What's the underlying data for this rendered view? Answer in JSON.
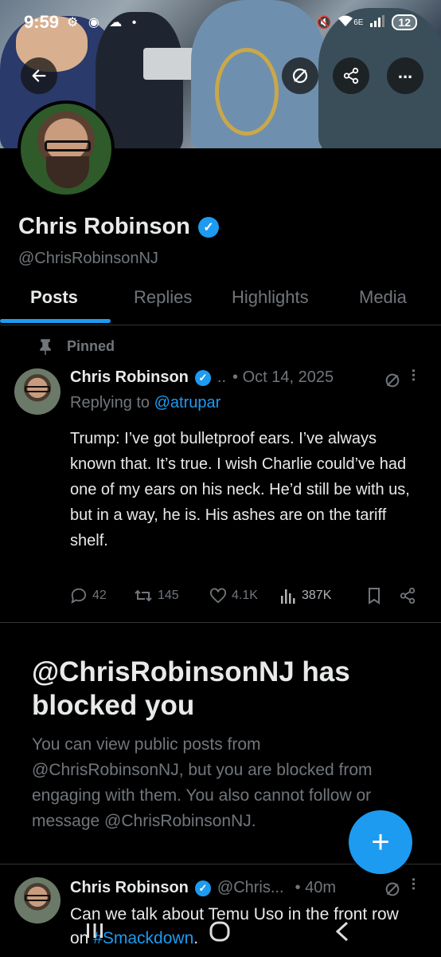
{
  "status_bar": {
    "time": "9:59",
    "battery": "12",
    "network": "6E"
  },
  "profile": {
    "name": "Chris Robinson",
    "handle": "@ChrisRobinsonNJ",
    "verified": true
  },
  "tabs": [
    {
      "label": "Posts",
      "active": true
    },
    {
      "label": "Replies",
      "active": false
    },
    {
      "label": "Highlights",
      "active": false
    },
    {
      "label": "Media",
      "active": false
    }
  ],
  "pinned_tweet": {
    "pinned_label": "Pinned",
    "author": "Chris Robinson",
    "handle_truncated": "..",
    "date": "• Oct 14, 2025",
    "replying_to_prefix": "Replying to",
    "replying_to_handle": "@atrupar",
    "text": "Trump: I’ve got bulletproof ears. I’ve always known that. It’s true. I wish Charlie could’ve had one of my ears on his neck. He’d still be with us, but in a way, he is. His ashes are on the tariff shelf.",
    "replies": "42",
    "reposts": "145",
    "likes": "4.1K",
    "views": "387K"
  },
  "blocked_notice": {
    "title": "@ChrisRobinsonNJ has blocked you",
    "description": "You can view public posts from @ChrisRobinsonNJ, but you are blocked from engaging with them. You also cannot follow or message @ChrisRobinsonNJ."
  },
  "second_tweet": {
    "author": "Chris Robinson",
    "handle": "@Chris...",
    "time": "• 40m",
    "text_before": "Can we talk about Temu Uso in the front row on ",
    "hashtag": "#Smackdown",
    "text_after": "."
  },
  "colors": {
    "accent": "#1d9bf0",
    "background": "#000000",
    "muted": "#71767b",
    "text": "#e7e9ea"
  }
}
